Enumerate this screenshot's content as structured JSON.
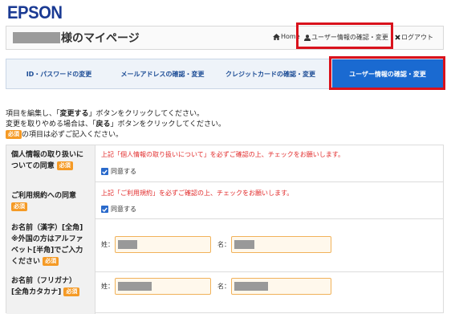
{
  "brand": {
    "logo_text": "EPSON",
    "logo_color": "#1a3a93"
  },
  "header": {
    "page_title": "様のマイページ",
    "home_label": "Home",
    "user_info_label": "ユーザー情報の確認・変更",
    "logout_label": "ログアウト"
  },
  "tabs": [
    {
      "label": "ID・パスワードの変更",
      "active": false
    },
    {
      "label": "メールアドレスの確認・変更",
      "active": false
    },
    {
      "label": "クレジットカードの確認・変更",
      "active": false
    },
    {
      "label": "ユーザー情報の確認・変更",
      "active": true
    }
  ],
  "instructions": {
    "line1_pre": "項目を編集し、「",
    "line1_bold": "変更する",
    "line1_post": "」ボタンをクリックしてください。",
    "line2_pre": "変更を取りやめる場合は、「",
    "line2_bold": "戻る",
    "line2_post": "」ボタンをクリックしてください。",
    "line3_badge": "必須",
    "line3_text": "の項目は必ずご記入ください。"
  },
  "form": {
    "required_badge": "必須",
    "privacy": {
      "label_line1": "個人情報の取り扱いに",
      "label_line2": "ついての同意",
      "notice": "上記「個人情報の取り扱いについて」を必ずご確認の上、チェックをお願いします。",
      "checkbox_label": "同意する",
      "checked": true
    },
    "terms": {
      "label": "ご利用規約への同意",
      "notice": "上記「ご利用規約」を必ずご確認の上、チェックをお願いします。",
      "checkbox_label": "同意する",
      "checked": true
    },
    "name_kanji": {
      "label_line1": "お名前（漢字）[全角]",
      "label_line2": "※外国の方はアルファ",
      "label_line3": "ベット[半角]でご入力",
      "label_line4": "ください",
      "last_label": "姓：",
      "first_label": "名："
    },
    "name_kana": {
      "label_line1": "お名前（フリガナ）",
      "label_line2": "[全角カタカナ]",
      "last_label": "姓：",
      "first_label": "名："
    }
  },
  "colors": {
    "highlight": "#d9121c",
    "active_tab": "#1a6ad1",
    "required": "#f59a25",
    "notice_text": "#e22c2c"
  }
}
